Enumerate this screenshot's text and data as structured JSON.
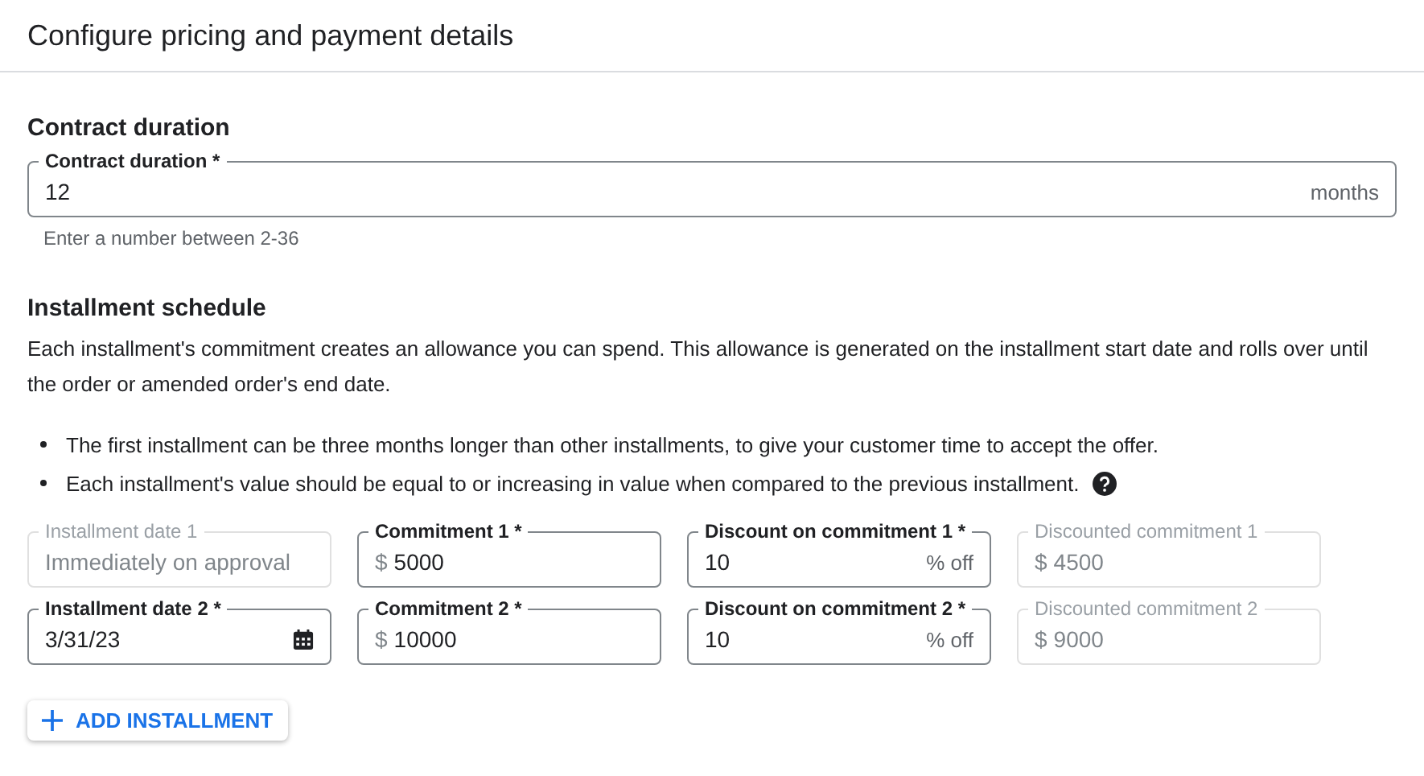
{
  "header": {
    "title": "Configure pricing and payment details"
  },
  "contract": {
    "heading": "Contract duration",
    "field": {
      "label": "Contract duration *",
      "value": "12",
      "suffix": "months",
      "disabled": false
    },
    "helper": "Enter a number between 2-36"
  },
  "schedule": {
    "heading": "Installment schedule",
    "description": "Each installment's commitment creates an allowance you can spend. This allowance is generated on the installment start date and rolls over until the order or amended order's end date.",
    "bullets": [
      {
        "text": "The first installment can be three months longer than other installments, to give your customer time to accept the offer.",
        "help": false
      },
      {
        "text": "Each installment's value should be equal to or increasing in value when compared to the previous installment.",
        "help": true
      }
    ],
    "rows": [
      {
        "fields": [
          {
            "kind": "date",
            "label": "Installment date 1",
            "value": "Immediately on approval",
            "disabled": true
          },
          {
            "kind": "text",
            "label": "Commitment 1 *",
            "prefix": "$",
            "value": "5000",
            "disabled": false
          },
          {
            "kind": "text",
            "label": "Discount on commitment 1 *",
            "value": "10",
            "suffix": "% off",
            "disabled": false
          },
          {
            "kind": "text",
            "label": "Discounted commitment 1",
            "prefix": "$",
            "value": "4500",
            "disabled": true
          }
        ]
      },
      {
        "fields": [
          {
            "kind": "date",
            "label": "Installment date 2 *",
            "value": "3/31/23",
            "disabled": false
          },
          {
            "kind": "text",
            "label": "Commitment 2 *",
            "prefix": "$",
            "value": "10000",
            "disabled": false
          },
          {
            "kind": "text",
            "label": "Discount on commitment 2 *",
            "value": "10",
            "suffix": "% off",
            "disabled": false
          },
          {
            "kind": "text",
            "label": "Discounted commitment 2",
            "prefix": "$",
            "value": "9000",
            "disabled": true
          }
        ]
      }
    ],
    "add_button": "ADD INSTALLMENT"
  }
}
